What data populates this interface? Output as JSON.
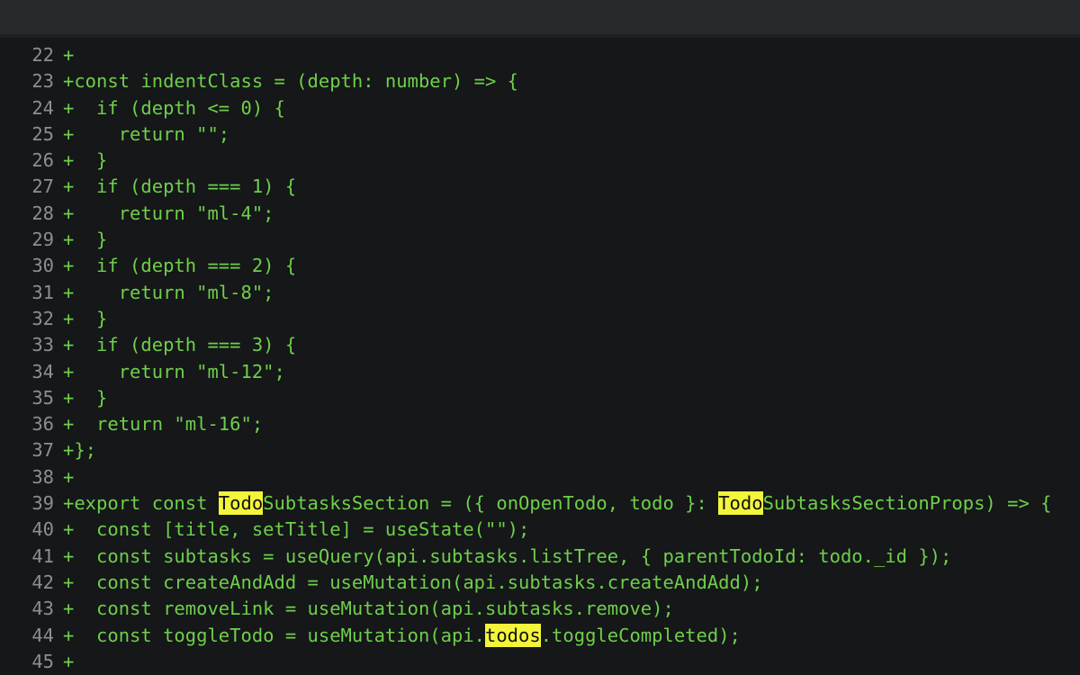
{
  "diff": {
    "lines": [
      {
        "num": "22",
        "segments": [
          {
            "text": "+",
            "hl": false
          }
        ]
      },
      {
        "num": "23",
        "segments": [
          {
            "text": "+const indentClass = (depth: number) => {",
            "hl": false
          }
        ]
      },
      {
        "num": "24",
        "segments": [
          {
            "text": "+  if (depth <= 0) {",
            "hl": false
          }
        ]
      },
      {
        "num": "25",
        "segments": [
          {
            "text": "+    return \"\";",
            "hl": false
          }
        ]
      },
      {
        "num": "26",
        "segments": [
          {
            "text": "+  }",
            "hl": false
          }
        ]
      },
      {
        "num": "27",
        "segments": [
          {
            "text": "+  if (depth === 1) {",
            "hl": false
          }
        ]
      },
      {
        "num": "28",
        "segments": [
          {
            "text": "+    return \"ml-4\";",
            "hl": false
          }
        ]
      },
      {
        "num": "29",
        "segments": [
          {
            "text": "+  }",
            "hl": false
          }
        ]
      },
      {
        "num": "30",
        "segments": [
          {
            "text": "+  if (depth === 2) {",
            "hl": false
          }
        ]
      },
      {
        "num": "31",
        "segments": [
          {
            "text": "+    return \"ml-8\";",
            "hl": false
          }
        ]
      },
      {
        "num": "32",
        "segments": [
          {
            "text": "+  }",
            "hl": false
          }
        ]
      },
      {
        "num": "33",
        "segments": [
          {
            "text": "+  if (depth === 3) {",
            "hl": false
          }
        ]
      },
      {
        "num": "34",
        "segments": [
          {
            "text": "+    return \"ml-12\";",
            "hl": false
          }
        ]
      },
      {
        "num": "35",
        "segments": [
          {
            "text": "+  }",
            "hl": false
          }
        ]
      },
      {
        "num": "36",
        "segments": [
          {
            "text": "+  return \"ml-16\";",
            "hl": false
          }
        ]
      },
      {
        "num": "37",
        "segments": [
          {
            "text": "+};",
            "hl": false
          }
        ]
      },
      {
        "num": "38",
        "segments": [
          {
            "text": "+",
            "hl": false
          }
        ]
      },
      {
        "num": "39",
        "segments": [
          {
            "text": "+export const ",
            "hl": false
          },
          {
            "text": "Todo",
            "hl": true
          },
          {
            "text": "SubtasksSection = ({ onOpenTodo, todo }: ",
            "hl": false
          },
          {
            "text": "Todo",
            "hl": true
          },
          {
            "text": "SubtasksSectionProps) => {",
            "hl": false
          }
        ]
      },
      {
        "num": "40",
        "segments": [
          {
            "text": "+  const [title, setTitle] = useState(\"\");",
            "hl": false
          }
        ]
      },
      {
        "num": "41",
        "segments": [
          {
            "text": "+  const subtasks = useQuery(api.subtasks.listTree, { parentTodoId: todo._id });",
            "hl": false
          }
        ]
      },
      {
        "num": "42",
        "segments": [
          {
            "text": "+  const createAndAdd = useMutation(api.subtasks.createAndAdd);",
            "hl": false
          }
        ]
      },
      {
        "num": "43",
        "segments": [
          {
            "text": "+  const removeLink = useMutation(api.subtasks.remove);",
            "hl": false
          }
        ]
      },
      {
        "num": "44",
        "segments": [
          {
            "text": "+  const toggleTodo = useMutation(api.",
            "hl": false
          },
          {
            "text": "todos",
            "hl": true
          },
          {
            "text": ".toggleCompleted);",
            "hl": false
          }
        ]
      },
      {
        "num": "45",
        "segments": [
          {
            "text": "+",
            "hl": false
          }
        ]
      }
    ]
  },
  "colors": {
    "added_text": "#6fcf4a",
    "line_number": "#8b8f95",
    "highlight": "#f3f53a",
    "background": "#151719",
    "top_bar": "#27292d"
  }
}
